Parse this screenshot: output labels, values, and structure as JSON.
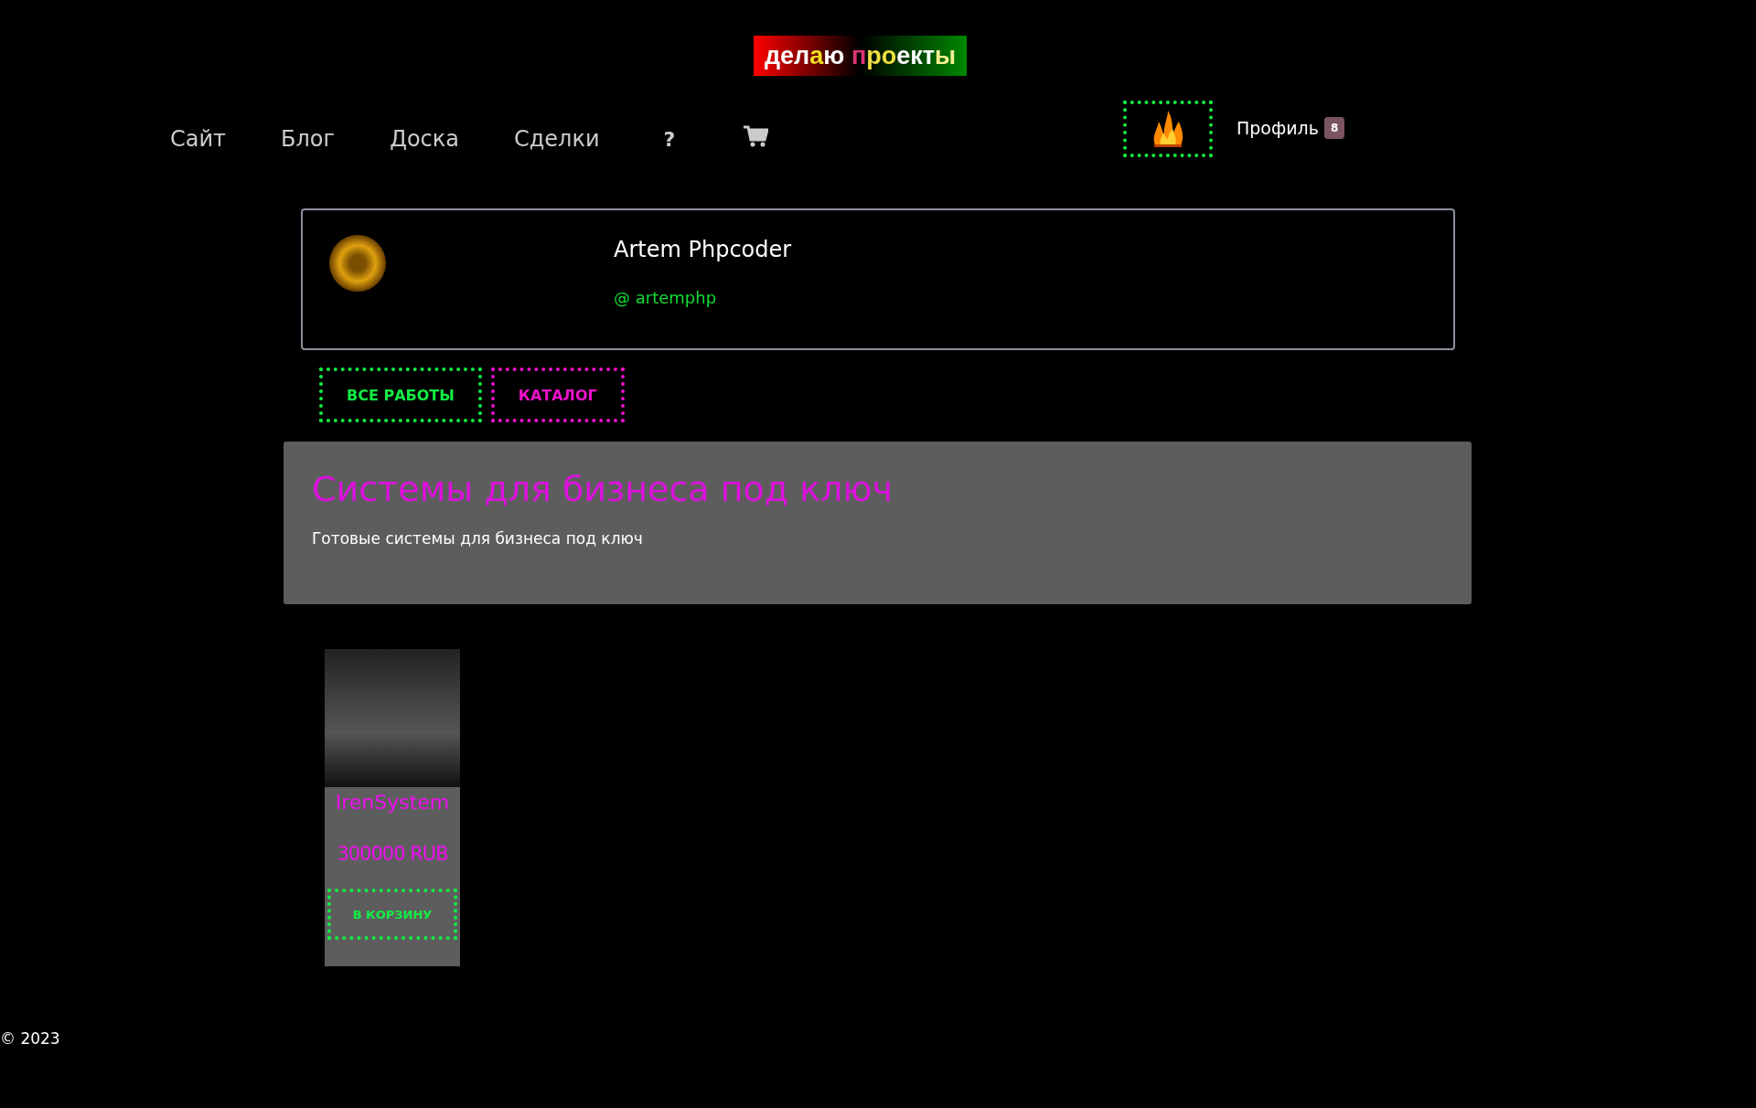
{
  "logo": {
    "parts": [
      {
        "text": "дел",
        "color": "#ffffff"
      },
      {
        "text": "а",
        "color": "#f0e020"
      },
      {
        "text": "ю ",
        "color": "#ffffff"
      },
      {
        "text": "п",
        "color": "#dd3377"
      },
      {
        "text": "ро",
        "color": "#f0e040"
      },
      {
        "text": "ект",
        "color": "#ffffff"
      },
      {
        "text": "ы",
        "color": "#f4f090"
      }
    ]
  },
  "nav": [
    {
      "kind": "link",
      "label": "Сайт"
    },
    {
      "kind": "link",
      "label": "Блог"
    },
    {
      "kind": "link",
      "label": "Доска"
    },
    {
      "kind": "link",
      "label": "Сделки"
    },
    {
      "kind": "link",
      "label": "?"
    },
    {
      "kind": "cart"
    }
  ],
  "profile_menu": {
    "label": "Профиль",
    "badge": "8"
  },
  "profile": {
    "name": "Artem Phpcoder",
    "handle": "@ artemphp"
  },
  "buttons": [
    {
      "label": "ВСЕ РАБОТЫ",
      "color": "#11ee44"
    },
    {
      "label": "КАТАЛОГ",
      "color": "#ee11cc"
    }
  ],
  "panel": {
    "title": "Системы для бизнеса под ключ",
    "subtitle": "Готовые системы для бизнеса под ключ"
  },
  "products": [
    {
      "name": "IrenSystem",
      "price": "300000 RUB",
      "button": "В КОРЗИНУ"
    }
  ],
  "footer": "© 2023"
}
